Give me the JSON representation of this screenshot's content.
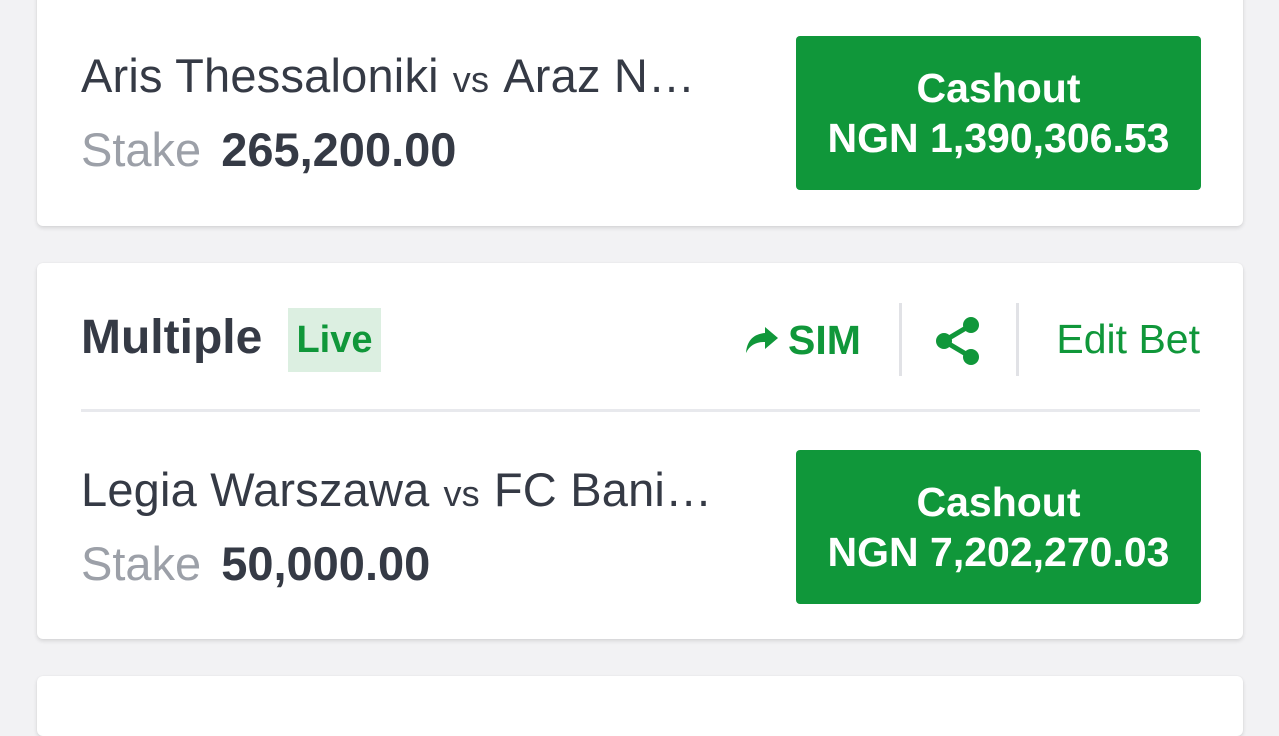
{
  "colors": {
    "accent_green": "#10973a",
    "live_badge_bg": "#dcefe1",
    "text_dark": "#353a45",
    "text_muted": "#9ca0a8"
  },
  "bets": [
    {
      "home": "Aris Thessaloniki",
      "vs": "vs",
      "away": "Araz N…",
      "stake_label": "Stake",
      "stake_amount": "265,200.00",
      "cashout_label": "Cashout",
      "cashout_amount": "NGN 1,390,306.53"
    },
    {
      "bet_type": "Multiple",
      "live_badge": "Live",
      "sim_label": "SIM",
      "sim_icon": "share-arrow-icon",
      "share_icon": "share-icon",
      "edit_bet_label": "Edit Bet",
      "home": "Legia Warszawa",
      "vs": "vs",
      "away": "FC Bani…",
      "stake_label": "Stake",
      "stake_amount": "50,000.00",
      "cashout_label": "Cashout",
      "cashout_amount": "NGN 7,202,270.03"
    }
  ]
}
